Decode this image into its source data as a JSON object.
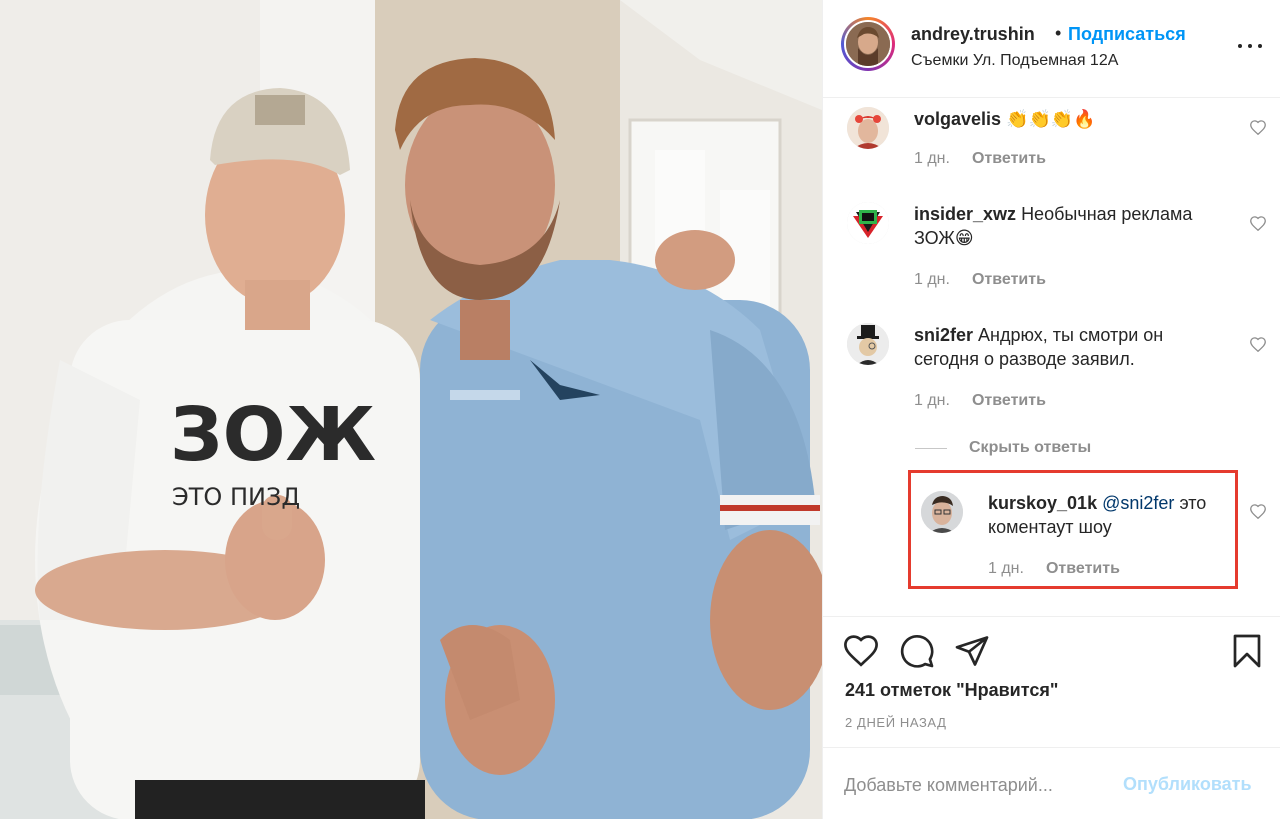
{
  "header": {
    "username": "andrey.trushin",
    "dot": "•",
    "follow_label": "Подписаться",
    "location": "Съемки Ул. Подъемная 12А"
  },
  "photo": {
    "shirt_text_main": "ЗОЖ",
    "shirt_text_sub": "ЭТО ПИЗД"
  },
  "comments": [
    {
      "username": "volgavelis",
      "text": "👏👏👏🔥",
      "age": "1 дн.",
      "reply": "Ответить"
    },
    {
      "username": "insider_xwz",
      "text": "Необычная реклама ЗОЖ😁",
      "age": "1 дн.",
      "reply": "Ответить"
    },
    {
      "username": "sni2fer",
      "text": "Андрюх, ты смотри он сегодня о разводе заявил.",
      "age": "1 дн.",
      "reply": "Ответить"
    }
  ],
  "hide_replies": "Скрыть ответы",
  "reply": {
    "username": "kurskoy_01k",
    "mention": "@sni2fer",
    "text": "это коментаут шоу",
    "age": "1 дн.",
    "reply": "Ответить"
  },
  "actions": {
    "likes": "241 отметок \"Нравится\"",
    "date": "2 ДНЕЙ НАЗАД",
    "comment_placeholder": "Добавьте комментарий...",
    "publish_label": "Опубликовать"
  },
  "colors": {
    "accent": "#0095f6",
    "highlight": "#e53b2e",
    "muted": "#8e8e8e"
  },
  "icons": [
    "heart-icon",
    "comment-icon",
    "share-icon",
    "bookmark-icon",
    "more-icon"
  ]
}
